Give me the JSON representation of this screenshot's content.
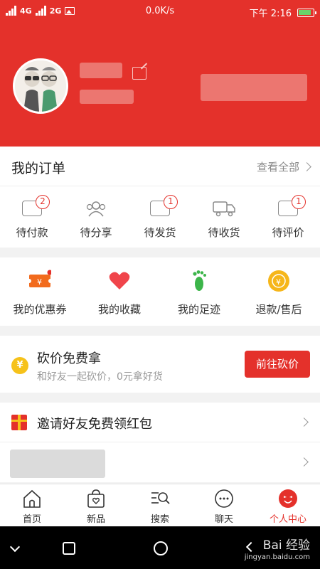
{
  "status_bar": {
    "network_1": "4G",
    "network_2": "2G",
    "speed": "0.0K/s",
    "time": "下午 2:16"
  },
  "orders": {
    "title": "我的订单",
    "view_all": "查看全部",
    "items": [
      {
        "label": "待付款",
        "icon": "wallet-icon",
        "badge": "2"
      },
      {
        "label": "待分享",
        "icon": "users-icon",
        "badge": ""
      },
      {
        "label": "待发货",
        "icon": "box-icon",
        "badge": "1"
      },
      {
        "label": "待收货",
        "icon": "truck-icon",
        "badge": ""
      },
      {
        "label": "待评价",
        "icon": "review-icon",
        "badge": "1"
      }
    ]
  },
  "services": [
    {
      "label": "我的优惠券",
      "icon": "coupon-icon"
    },
    {
      "label": "我的收藏",
      "icon": "heart-icon"
    },
    {
      "label": "我的足迹",
      "icon": "footprint-icon"
    },
    {
      "label": "退款/售后",
      "icon": "refund-icon"
    }
  ],
  "bargain": {
    "title": "砍价免费拿",
    "subtitle": "和好友一起砍价，0元拿好货",
    "button": "前往砍价",
    "coin_symbol": "¥"
  },
  "invite": {
    "label": "邀请好友免费领红包"
  },
  "tabs": [
    {
      "label": "首页",
      "icon": "home-icon"
    },
    {
      "label": "新品",
      "icon": "bag-icon"
    },
    {
      "label": "搜索",
      "icon": "search-icon"
    },
    {
      "label": "聊天",
      "icon": "chat-icon"
    },
    {
      "label": "个人中心",
      "icon": "profile-icon",
      "active": true
    }
  ],
  "watermark": {
    "text": "Bai 经验",
    "sub": "jingyan.baidu.com"
  },
  "colors": {
    "accent": "#e4312b",
    "coin": "#f6c21a",
    "green": "#3cb54a",
    "coupon_orange": "#f26b1d"
  }
}
